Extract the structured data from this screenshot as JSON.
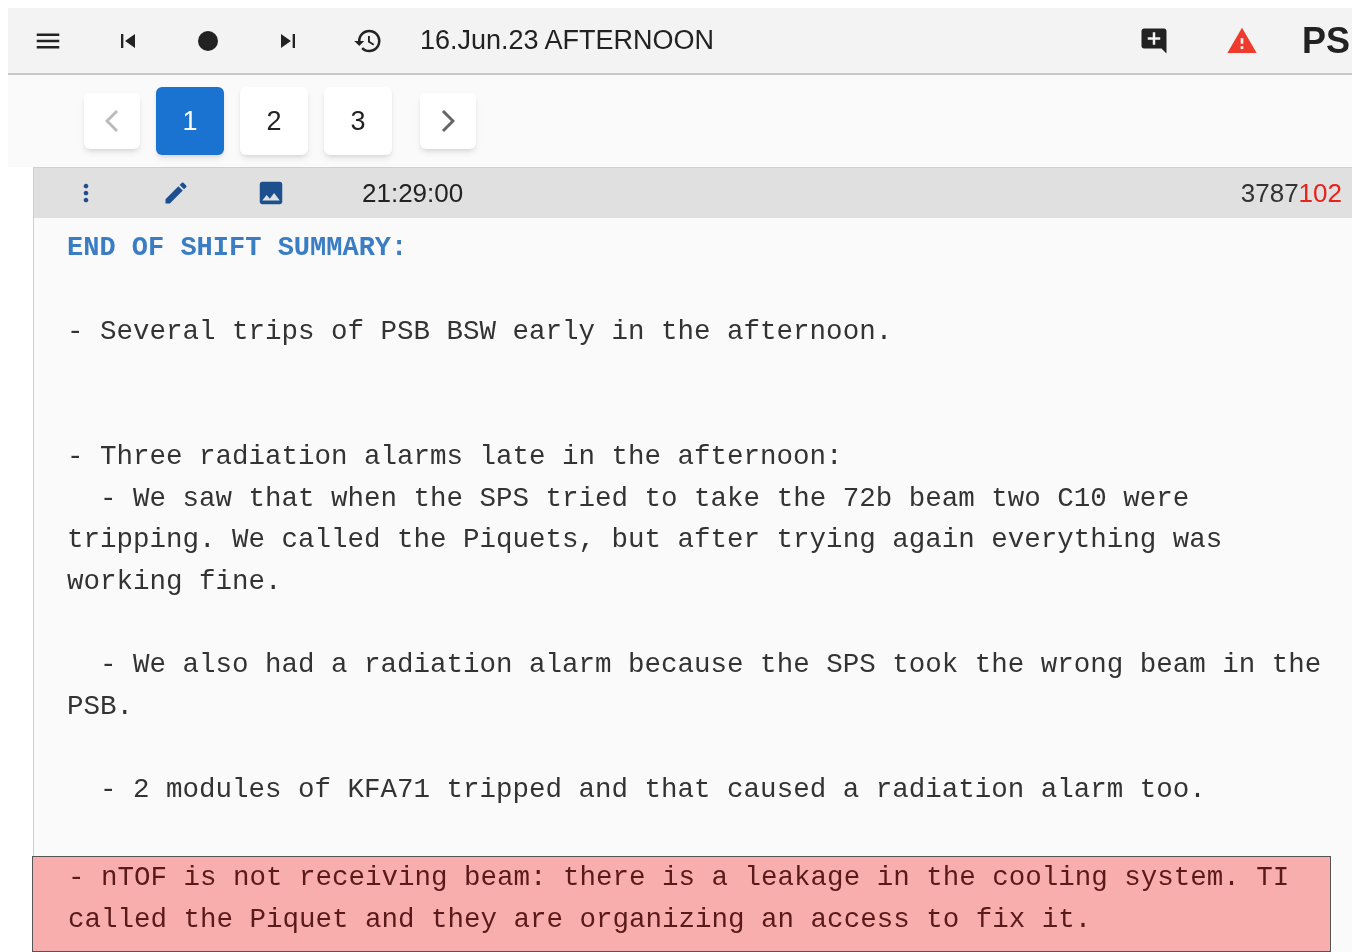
{
  "toolbar": {
    "title": "16.Jun.23 AFTERNOON",
    "section": "PS"
  },
  "pagination": {
    "previous_disabled": true,
    "next_disabled": false,
    "pages": [
      {
        "label": "1",
        "selected": true
      },
      {
        "label": "2",
        "selected": false
      },
      {
        "label": "3",
        "selected": false
      }
    ]
  },
  "entry": {
    "time": "21:29:00",
    "number_parts": [
      {
        "text": "3787",
        "highlight": false
      },
      {
        "text": "102",
        "highlight": true
      }
    ],
    "blocks": [
      {
        "kind": "heading",
        "text": "END OF SHIFT SUMMARY:"
      },
      {
        "kind": "text",
        "text": "\n- Several trips of PSB BSW early in the afternoon.\n\n\n- Three radiation alarms late in the afternoon:\n  - We saw that when the SPS tried to take the 72b beam two C10 were tripping. We called the Piquets, but after trying again everything was working fine.\n\n  - We also had a radiation alarm because the SPS took the wrong beam in the PSB.\n\n  - 2 modules of KFA71 tripped and that caused a radiation alarm too."
      },
      {
        "kind": "highlight",
        "text": "- nTOF is not receiving beam: there is a leakage in the cooling system. TI called the Piquet and they are organizing an access to fix it."
      }
    ]
  }
}
